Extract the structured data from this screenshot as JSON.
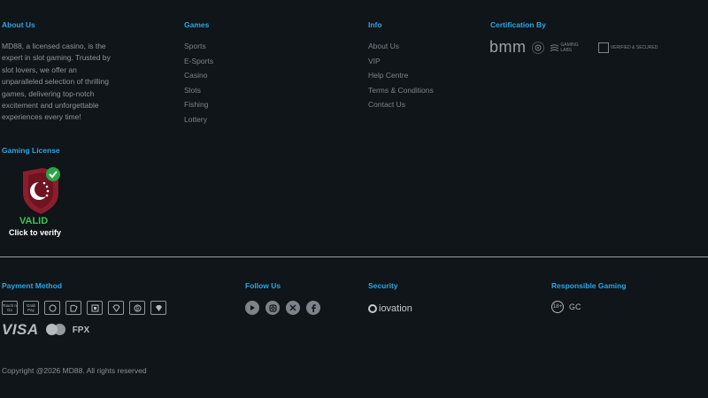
{
  "about": {
    "heading": "About Us",
    "text": "MD88, a licensed casino, is the expert in slot gaming. Trusted by slot lovers, we offer an unparalleled selection of thrilling games, delivering top-notch excitement and unforgettable experiences every time!"
  },
  "games": {
    "heading": "Games",
    "items": [
      "Sports",
      "E-Sports",
      "Casino",
      "Slots",
      "Fishing",
      "Lottery"
    ]
  },
  "info": {
    "heading": "Info",
    "items": [
      "About Us",
      "VIP",
      "Help Centre",
      "Terms & Conditions",
      "Contact Us"
    ]
  },
  "certification": {
    "heading": "Certification By",
    "bmm": "bmm",
    "logo2": "GAMING LABS",
    "logo3": "VERIFIED & SECURED"
  },
  "license": {
    "heading": "Gaming License",
    "valid": "VALID",
    "verify": "Click to verify"
  },
  "payment": {
    "heading": "Payment Method",
    "chips": [
      "Touch n Go",
      "Grab Pay",
      "Boost",
      "DuitNow",
      "QR",
      "USDT",
      "BTC",
      "USDT"
    ],
    "visa": "VISA",
    "fpx": "FPX"
  },
  "follow": {
    "heading": "Follow Us",
    "icons": [
      "youtube-icon",
      "instagram-icon",
      "x-icon",
      "facebook-icon"
    ]
  },
  "security": {
    "heading": "Security",
    "brand": "iovation"
  },
  "responsible": {
    "heading": "Responsible Gaming",
    "age": "18+",
    "gc": "GC"
  },
  "copyright": "Copyright @2026 MD88. All rights reserved",
  "colors": {
    "background": "#0f1518",
    "heading": "#2aa6e6",
    "valid": "#3cc052",
    "badge_red": "#8c1d2c",
    "badge_check": "#27a844"
  }
}
